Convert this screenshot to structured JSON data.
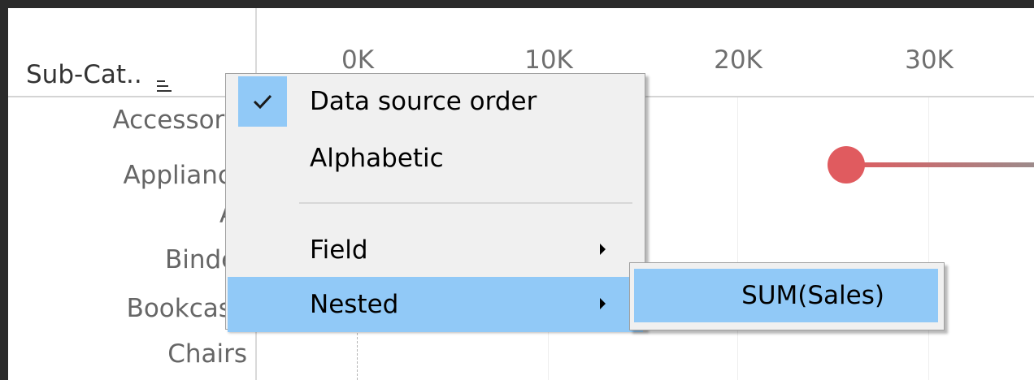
{
  "field_header": {
    "label": "Sub-Cat..",
    "sort_icon": "sort-descending-icon"
  },
  "row_labels": [
    "Accessorie",
    "Appliance",
    "Ar",
    "Binder",
    "Bookcase",
    "Chairs"
  ],
  "axis": {
    "ticks": [
      "0K",
      "10K",
      "20K",
      "30K"
    ]
  },
  "context_menu": {
    "items": [
      {
        "label": "Data source order",
        "checked": true
      },
      {
        "label": "Alphabetic"
      },
      {
        "label": "Field",
        "has_submenu": true
      },
      {
        "label": "Nested",
        "has_submenu": true,
        "highlighted": true
      }
    ]
  },
  "submenu": {
    "items": [
      {
        "label": "SUM(Sales)",
        "highlighted": true
      }
    ]
  },
  "colors": {
    "highlight": "#91c9f7",
    "mark": "#e05b5f",
    "background": "#2b2b2b"
  }
}
